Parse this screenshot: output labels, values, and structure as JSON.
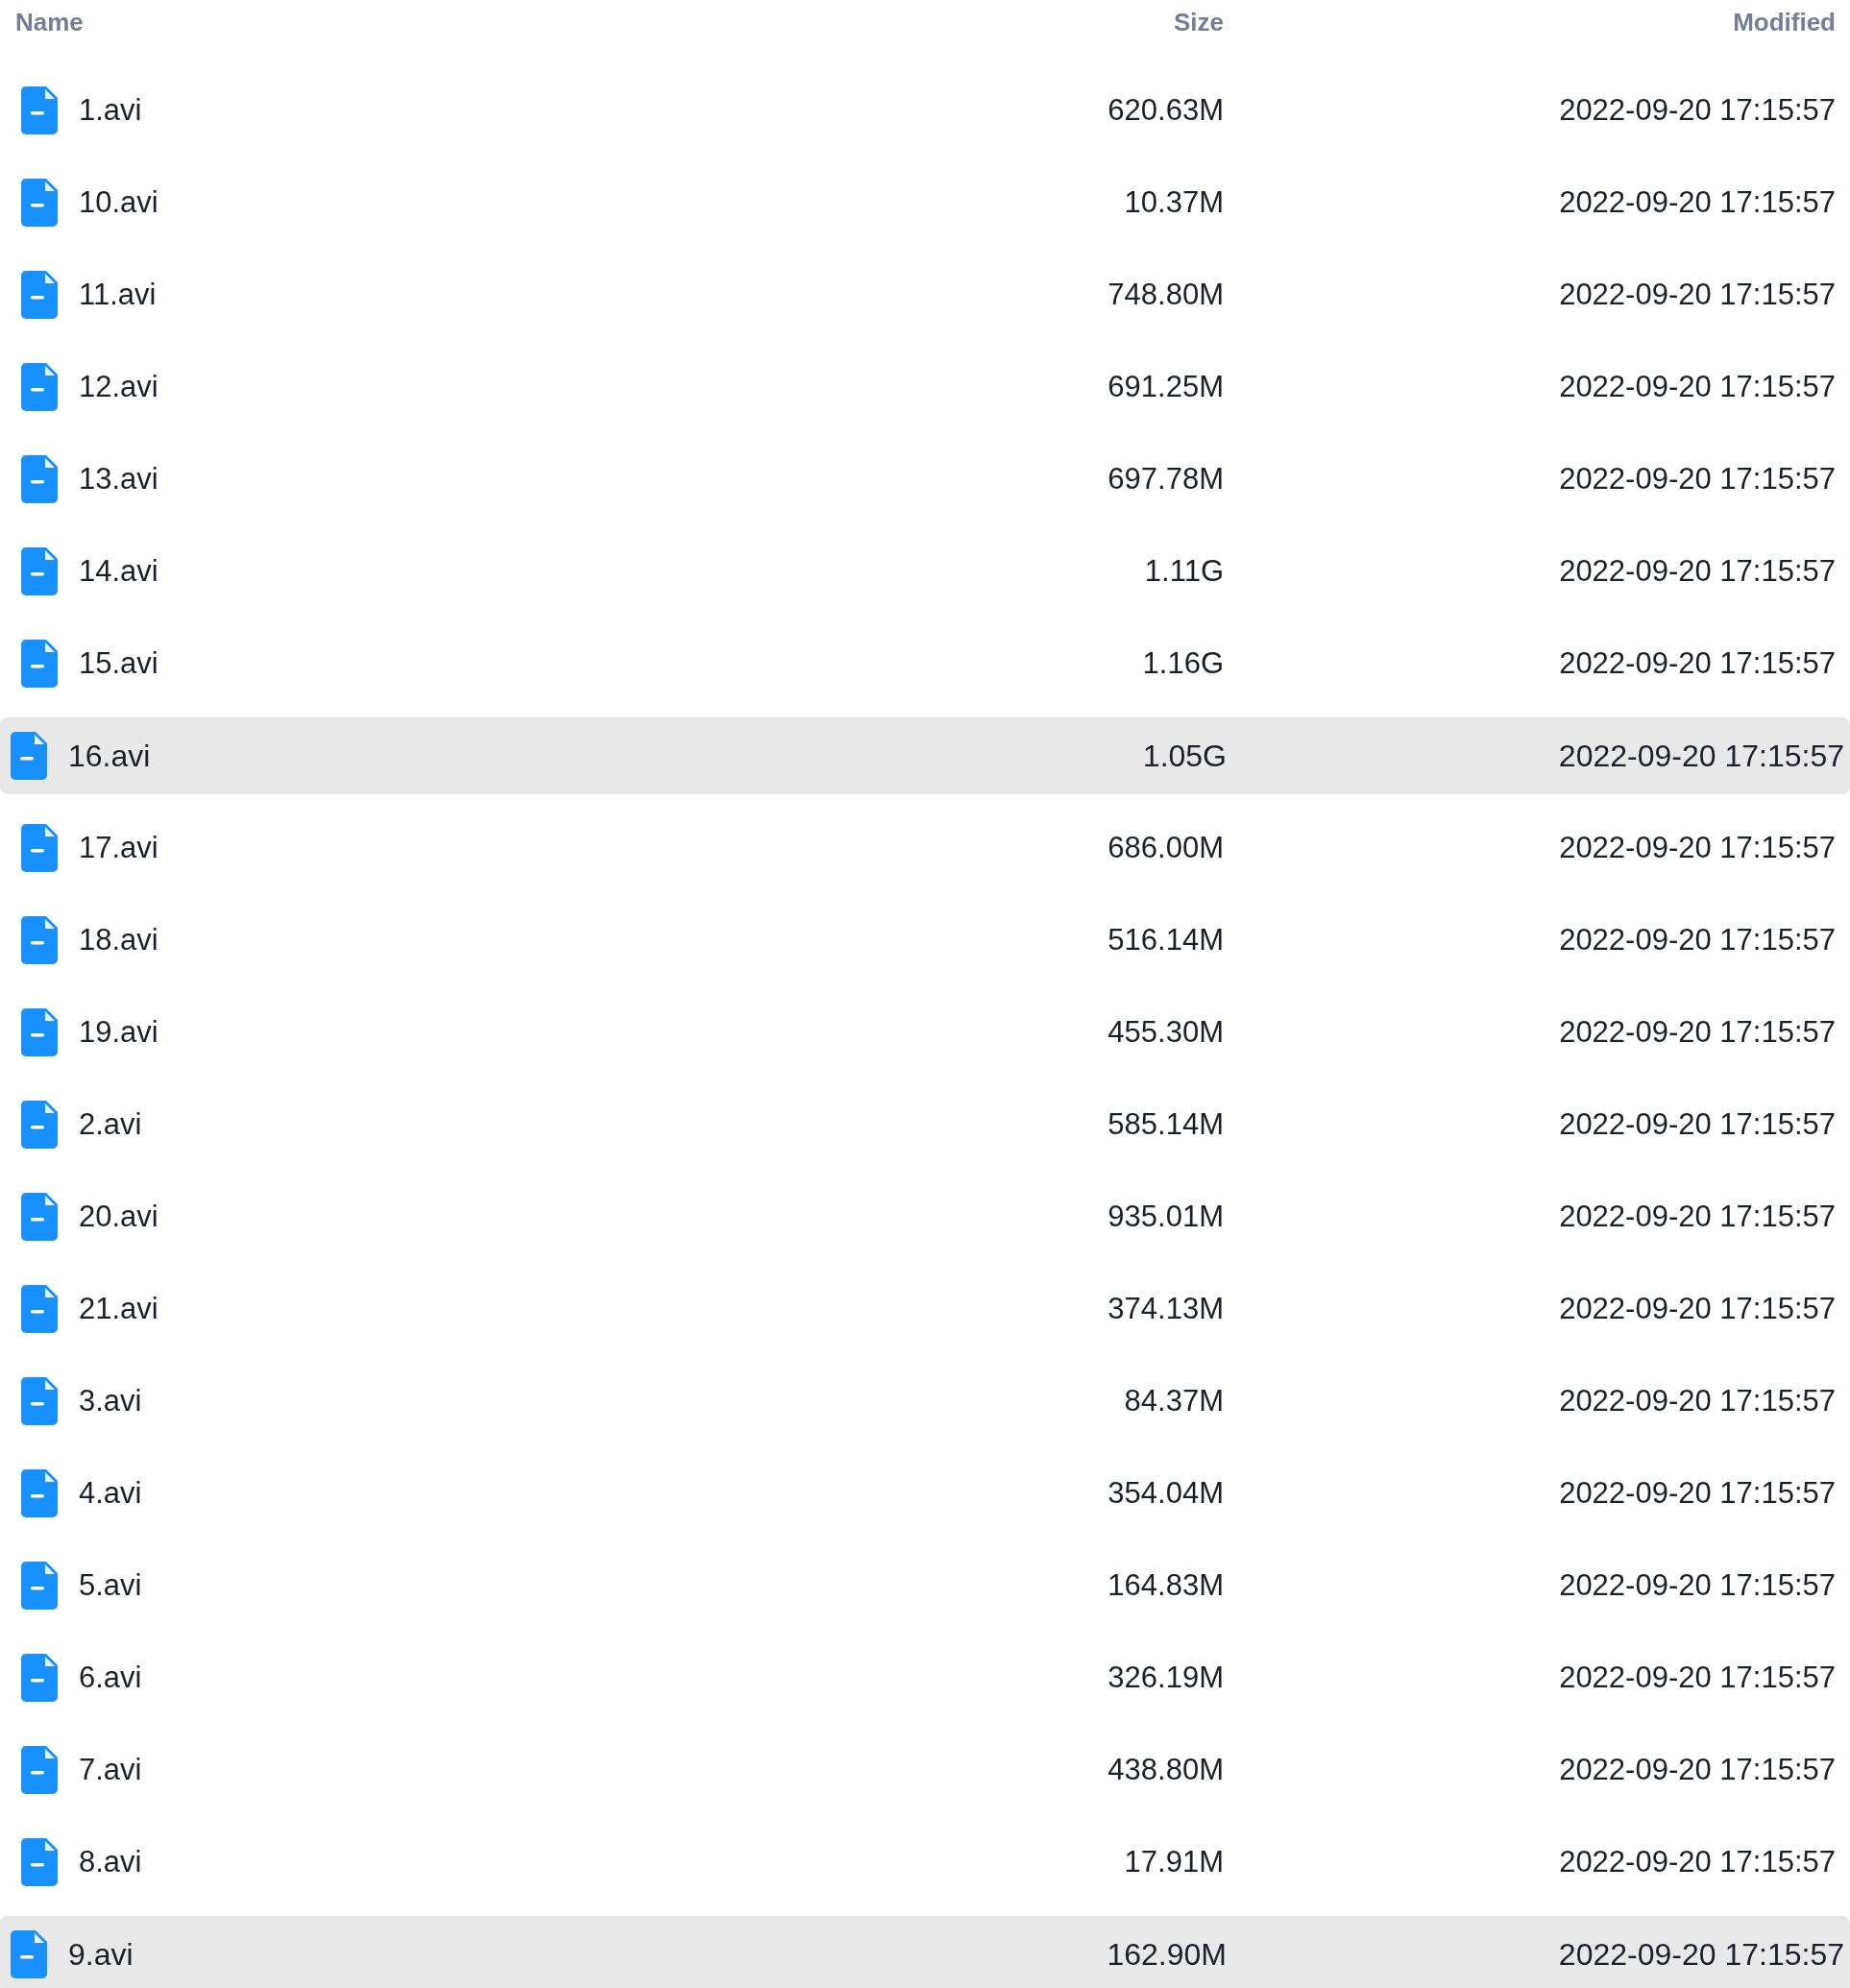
{
  "table": {
    "columns": [
      "Name",
      "Size",
      "Modified"
    ],
    "rows": [
      {
        "name": "1.avi",
        "size": "620.63M",
        "modified": "2022-09-20 17:15:57",
        "selected": false
      },
      {
        "name": "10.avi",
        "size": "10.37M",
        "modified": "2022-09-20 17:15:57",
        "selected": false
      },
      {
        "name": "11.avi",
        "size": "748.80M",
        "modified": "2022-09-20 17:15:57",
        "selected": false
      },
      {
        "name": "12.avi",
        "size": "691.25M",
        "modified": "2022-09-20 17:15:57",
        "selected": false
      },
      {
        "name": "13.avi",
        "size": "697.78M",
        "modified": "2022-09-20 17:15:57",
        "selected": false
      },
      {
        "name": "14.avi",
        "size": "1.11G",
        "modified": "2022-09-20 17:15:57",
        "selected": false
      },
      {
        "name": "15.avi",
        "size": "1.16G",
        "modified": "2022-09-20 17:15:57",
        "selected": false
      },
      {
        "name": "16.avi",
        "size": "1.05G",
        "modified": "2022-09-20 17:15:57",
        "selected": true
      },
      {
        "name": "17.avi",
        "size": "686.00M",
        "modified": "2022-09-20 17:15:57",
        "selected": false
      },
      {
        "name": "18.avi",
        "size": "516.14M",
        "modified": "2022-09-20 17:15:57",
        "selected": false
      },
      {
        "name": "19.avi",
        "size": "455.30M",
        "modified": "2022-09-20 17:15:57",
        "selected": false
      },
      {
        "name": "2.avi",
        "size": "585.14M",
        "modified": "2022-09-20 17:15:57",
        "selected": false
      },
      {
        "name": "20.avi",
        "size": "935.01M",
        "modified": "2022-09-20 17:15:57",
        "selected": false
      },
      {
        "name": "21.avi",
        "size": "374.13M",
        "modified": "2022-09-20 17:15:57",
        "selected": false
      },
      {
        "name": "3.avi",
        "size": "84.37M",
        "modified": "2022-09-20 17:15:57",
        "selected": false
      },
      {
        "name": "4.avi",
        "size": "354.04M",
        "modified": "2022-09-20 17:15:57",
        "selected": false
      },
      {
        "name": "5.avi",
        "size": "164.83M",
        "modified": "2022-09-20 17:15:57",
        "selected": false
      },
      {
        "name": "6.avi",
        "size": "326.19M",
        "modified": "2022-09-20 17:15:57",
        "selected": false
      },
      {
        "name": "7.avi",
        "size": "438.80M",
        "modified": "2022-09-20 17:15:57",
        "selected": false
      },
      {
        "name": "8.avi",
        "size": "17.91M",
        "modified": "2022-09-20 17:15:57",
        "selected": false
      },
      {
        "name": "9.avi",
        "size": "162.90M",
        "modified": "2022-09-20 17:15:57",
        "selected": true
      }
    ]
  }
}
